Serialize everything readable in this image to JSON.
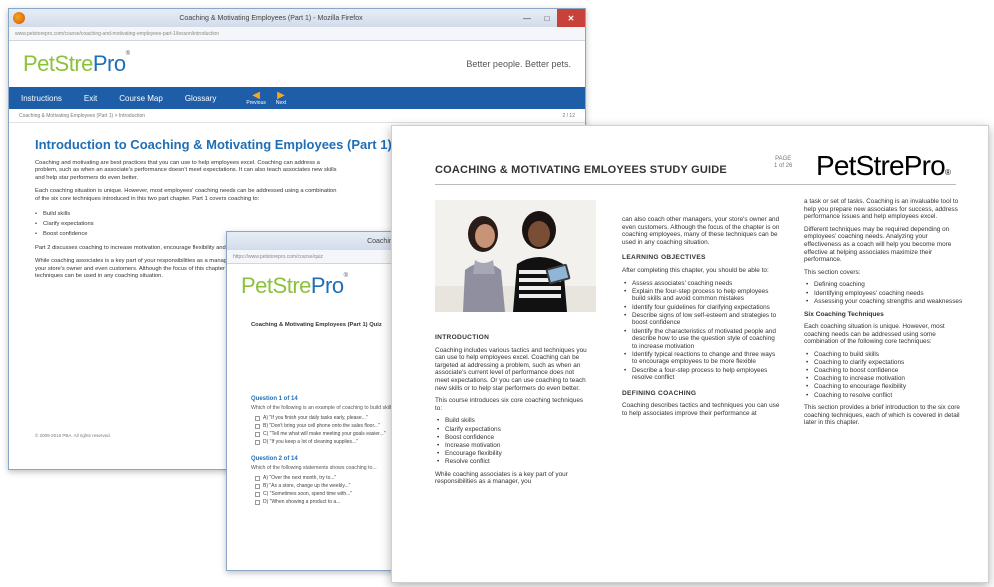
{
  "window1": {
    "title": "Coaching & Motivating Employees (Part 1) - Mozilla Firefox",
    "url": "www.petstorepro.com/course/coaching-and-motivating-employees-part-1/lesson/introduction",
    "logo": {
      "part1": "PetSt",
      "part2": "re",
      "part3": "Pro"
    },
    "tagline": "Better people. Better pets.",
    "nav": [
      "Instructions",
      "Exit",
      "Course Map",
      "Glossary"
    ],
    "prev_label": "Previous",
    "next_label": "Next",
    "breadcrumb": "Coaching & Motivating Employees (Part 1) > Introduction",
    "page_count": "2 / 12",
    "heading": "Introduction to Coaching & Motivating Employees (Part 1)",
    "paragraphs": [
      "Coaching and motivating are best practices that you can use to help employees excel. Coaching can address a problem, such as when an associate's performance doesn't meet expectations. It can also teach associates new skills and help star performers do even better.",
      "Each coaching situation is unique. However, most employees' coaching needs can be addressed using a combination of the six core techniques introduced in this two part chapter. Part 1 covers coaching to:"
    ],
    "bullets": [
      "Build skills",
      "Clarify expectations",
      "Boost confidence"
    ],
    "paragraphs2": [
      "Part 2 discusses coaching to increase motivation, encourage flexibility and resolve conflict.",
      "While coaching associates is a key part of your responsibilities as a manager, you can also coach other managers, your store's owner and even customers. Although the focus of this chapter is on coaching employees, many of these techniques can be used in any coaching situation."
    ],
    "footer": "© 2009-2016 PBA. All rights reserved."
  },
  "window2": {
    "title": "Coaching & Motivating Employees (Part 1)",
    "url": "https://www.petstorepro.com/course/quiz",
    "quiz_heading": "Coaching & Motivating Employees (Part 1) Quiz",
    "questions": [
      {
        "title": "Question 1 of 14",
        "prompt": "Which of the following is an example of coaching to build skills?",
        "options": [
          "A) \"If you finish your daily tasks early, please...\"",
          "B) \"Don't bring your cell phone onto the sales floor...\"",
          "C) \"Tell me what will make meeting your goals easier...\"",
          "D) \"If you keep a lot of cleaning supplies...\""
        ]
      },
      {
        "title": "Question 2 of 14",
        "prompt": "Which of the following statements shows coaching to...",
        "options": [
          "A) \"Over the next month, try to...\"",
          "B) \"As a store, change up the weekly...\"",
          "C) \"Sometimes soon, spend time with...\"",
          "D) \"When showing a product to a..."
        ]
      }
    ]
  },
  "guide": {
    "title": "COACHING & MOTIVATING EMLOYEES STUDY GUIDE",
    "page_label": "PAGE",
    "page_num": "1 of 26",
    "logo": {
      "part1": "PetSt",
      "part2": "re",
      "part3": "Pro"
    },
    "col1": {
      "heading": "INTRODUCTION",
      "p1": "Coaching includes various tactics and techniques you can use to help employees excel. Coaching can be targeted at addressing a problem, such as when an associate's current level of performance does not meet expectations. Or you can use coaching to teach new skills or to help star performers do even better.",
      "p2": "This course introduces six core coaching techniques to:",
      "bullets": [
        "Build skills",
        "Clarify expectations",
        "Boost confidence",
        "Increase motivation",
        "Encourage flexibility",
        "Resolve conflict"
      ],
      "p3": "While coaching associates is a key part of your responsibilities as a manager, you"
    },
    "col2": {
      "p1": "can also coach other managers, your store's owner and even customers. Although the focus of the chapter is on coaching employees, many of these techniques can be used in any coaching situation.",
      "heading1": "LEARNING OBJECTIVES",
      "p2": "After completing this chapter, you should be able to:",
      "bullets": [
        "Assess associates' coaching needs",
        "Explain the four-step process to help employees build skills and avoid common mistakes",
        "Identify four guidelines for clarifying expectations",
        "Describe signs of low self-esteem and strategies to boost confidence",
        "Identify the characteristics of motivated people and describe how to use the question style of coaching to increase motivation",
        "Identify typical reactions to change and three ways to encourage employees to be more flexible",
        "Describe a four-step process to help employees resolve conflict"
      ],
      "heading2": "DEFINING COACHING",
      "p3": "Coaching describes tactics and techniques you can use to help associates improve their performance at"
    },
    "col3": {
      "p1": "a task or set of tasks. Coaching is an invaluable tool to help you prepare new associates for success, address performance issues and help employees excel.",
      "p2": "Different techniques may be required depending on employees' coaching needs. Analyzing your effectiveness as a coach will help you become more effective at helping associates maximize their performance.",
      "p3": "This section covers:",
      "bullets": [
        "Defining coaching",
        "Identifying employees' coaching needs",
        "Assessing your coaching strengths and weaknesses"
      ],
      "heading": "Six Coaching Techniques",
      "p4": "Each coaching situation is unique. However, most coaching needs can be addressed using some combination of the following core techniques:",
      "bullets2": [
        "Coaching to build skills",
        "Coaching to clarify expectations",
        "Coaching to boost confidence",
        "Coaching to increase motivation",
        "Coaching to encourage flexibility",
        "Coaching to resolve conflict"
      ],
      "p5": "This section provides a brief introduction to the six core coaching techniques, each of which is covered in detail later in this chapter."
    }
  },
  "colors": {
    "brand_blue": "#1e6fb8",
    "brand_green": "#8bc23a",
    "nav_blue": "#1e5ea8",
    "close_red": "#c9423a"
  }
}
